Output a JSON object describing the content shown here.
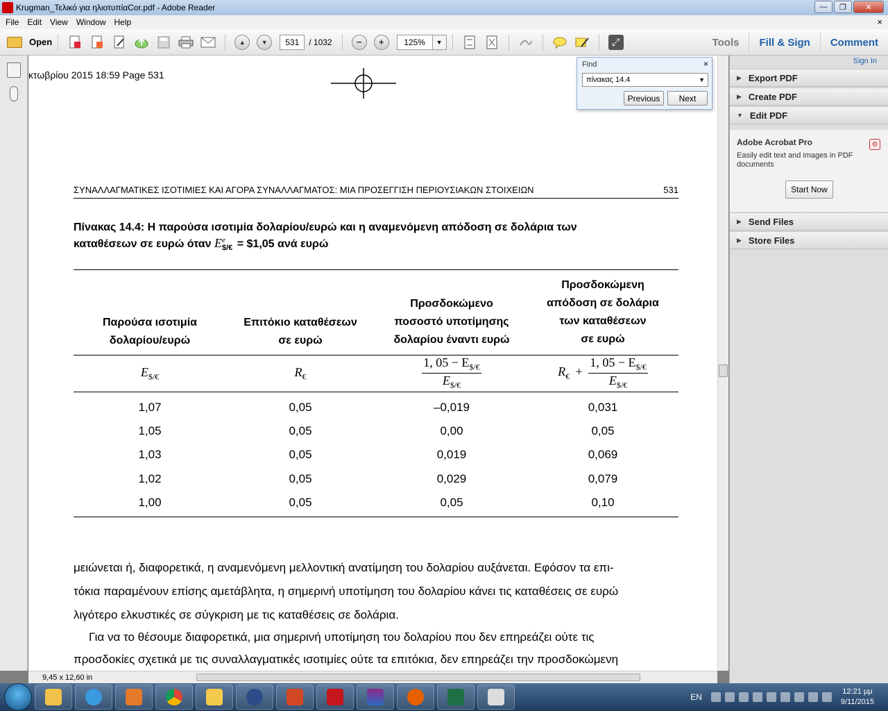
{
  "window": {
    "title": "Krugman_Τελικό για ηλιοτυπίαCor.pdf - Adobe Reader",
    "minimize_glyph": "—",
    "restore_glyph": "❐",
    "close_glyph": "✕"
  },
  "menu": {
    "items": [
      "File",
      "Edit",
      "View",
      "Window",
      "Help"
    ],
    "close_glyph": "×"
  },
  "toolbar": {
    "open_label": "Open",
    "up_glyph": "▲",
    "down_glyph": "▼",
    "current_page": "531",
    "total_pages": "/ 1032",
    "zoom_out_glyph": "−",
    "zoom_in_glyph": "+",
    "zoom_level": "125%",
    "tools_label": "Tools",
    "fill_sign_label": "Fill & Sign",
    "comment_label": "Comment"
  },
  "document": {
    "crop_header": "κτωβρίου 2015  18:59  Page 531",
    "running_head_title": "ΣΥΝΑΛΛΑΓΜΑΤΙΚΕΣ ΙΣΟΤΙΜΙΕΣ ΚΑΙ ΑΓΟΡΑ ΣΥΝΑΛΛΑΓΜΑΤΟΣ: ΜΙΑ ΠΡΟΣΕΓΓΙΣΗ ΠΕΡΙΟΥΣΙΑΚΩΝ ΣΤΟΙΧΕΙΩΝ",
    "running_head_page": "531",
    "caption_line1": "Πίνακας 14.4: Η παρούσα ισοτιμία δολαρίου/ευρώ και η αναμενόμενη απόδοση σε δολάρια των",
    "caption_line2_pre": "καταθέσεων σε ευρώ όταν ",
    "caption_symbol": "E",
    "caption_superscript": "e",
    "caption_subscript": "$/€",
    "caption_line2_post": " = $1,05 ανά ευρώ",
    "table": {
      "headers": [
        [
          "Παρούσα ισοτιμία",
          "δολαρίου/ευρώ"
        ],
        [
          "Επιτόκιο καταθέσεων",
          "σε ευρώ"
        ],
        [
          "Προσδοκώμενο",
          "ποσοστό υποτίμησης",
          "δολαρίου έναντι ευρώ"
        ],
        [
          "Προσδοκώμενη",
          "απόδοση σε δολάρια",
          "των καταθέσεων",
          "σε ευρώ"
        ]
      ],
      "symbol_e": "E",
      "symbol_r": "R",
      "sub_rate": "$/€",
      "sub_euro": "€",
      "frac_num": "1, 05 − E",
      "plus": "+",
      "rows": [
        [
          "1,07",
          "0,05",
          "–0,019",
          "0,031"
        ],
        [
          "1,05",
          "0,05",
          "0,00",
          "0,05"
        ],
        [
          "1,03",
          "0,05",
          "0,019",
          "0,069"
        ],
        [
          "1,02",
          "0,05",
          "0,029",
          "0,079"
        ],
        [
          "1,00",
          "0,05",
          "0,05",
          "0,10"
        ]
      ]
    },
    "body_lines": [
      "μειώνεται ή, διαφορετικά, η αναμενόμενη μελλοντική ανατίμηση του δολαρίου αυξάνεται. Εφόσον τα επι-",
      "τόκια παραμένουν επίσης αμετάβλητα, η σημερινή υποτίμηση του δολαρίου κάνει τις καταθέσεις σε ευρώ",
      "λιγότερο ελκυστικές σε σύγκριση με τις καταθέσεις σε δολάρια.",
      "Για να το θέσουμε διαφορετικά, μια σημερινή υποτίμηση του δολαρίου που δεν επηρεάζει ούτε τις",
      "προσδοκίες σχετικά με τις συναλλαγματικές ισοτιμίες ούτε τα επιτόκια, δεν επηρεάζει την προσδοκώμενη"
    ]
  },
  "status": {
    "page_size": "9,45 x 12,60 in"
  },
  "find": {
    "title": "Find",
    "close_glyph": "×",
    "query": "πίνακας 14.4",
    "dropdown_glyph": "▼",
    "previous_label": "Previous",
    "next_label": "Next"
  },
  "right_pane": {
    "sign_in": "Sign In",
    "export_pdf": "Export PDF",
    "create_pdf": "Create PDF",
    "edit_pdf": "Edit PDF",
    "collapsed_arrow": "▶",
    "expanded_arrow": "▼",
    "pro_title": "Adobe Acrobat Pro",
    "pro_desc": "Easily edit text and images in PDF documents",
    "start_now": "Start Now",
    "send_files": "Send Files",
    "store_files": "Store Files"
  },
  "taskbar": {
    "language": "EN",
    "time": "12:21 μμ",
    "date": "9/11/2015"
  },
  "colors": {
    "accent_blue": "#2060a8",
    "taskbar": "#1d3b5f",
    "find_panel": "#e9f1fa"
  }
}
